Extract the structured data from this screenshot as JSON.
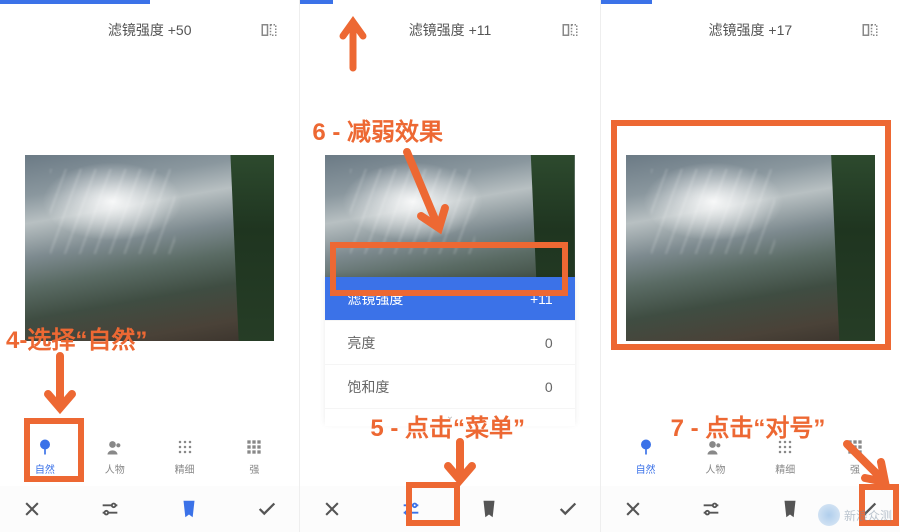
{
  "colors": {
    "accent": "#3b72e8",
    "annotation": "#ed6833"
  },
  "screens": [
    {
      "strength_label": "滤镜强度 +50",
      "progress": 50,
      "tabs": [
        {
          "label": "自然",
          "active": true
        },
        {
          "label": "人物",
          "active": false
        },
        {
          "label": "精细",
          "active": false
        },
        {
          "label": "强",
          "active": false
        }
      ]
    },
    {
      "strength_label": "滤镜强度 +11",
      "progress": 11,
      "adjust_panel": [
        {
          "label": "滤镜强度",
          "value": "+11",
          "selected": true
        },
        {
          "label": "亮度",
          "value": "0",
          "selected": false
        },
        {
          "label": "饱和度",
          "value": "0",
          "selected": false
        }
      ]
    },
    {
      "strength_label": "滤镜强度 +17",
      "progress": 17,
      "tabs": [
        {
          "label": "自然",
          "active": true
        },
        {
          "label": "人物",
          "active": false
        },
        {
          "label": "精细",
          "active": false
        },
        {
          "label": "强",
          "active": false
        }
      ]
    }
  ],
  "bottom_bar": {
    "close": "close",
    "adjust": "adjust",
    "styles": "styles",
    "confirm": "confirm"
  },
  "annotations": {
    "step4": "4-选择“自然”",
    "step5": "5 - 点击“菜单”",
    "step6": "6 - 减弱效果",
    "step7": "7 - 点击“对号”"
  },
  "watermark": "新浪众测"
}
